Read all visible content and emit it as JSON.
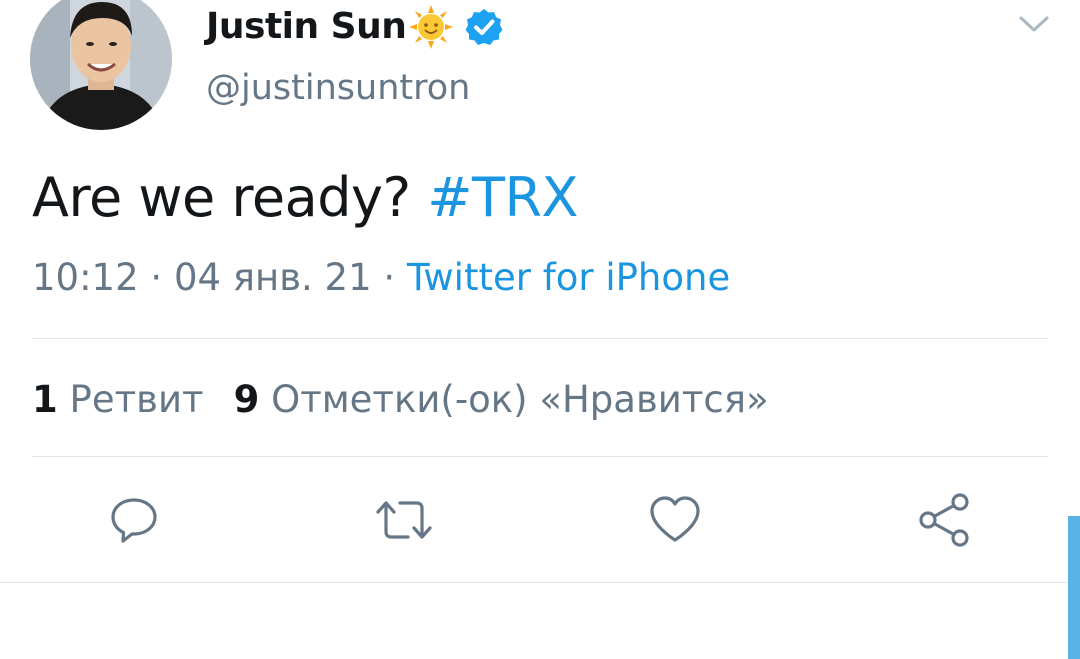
{
  "user": {
    "display_name": "Justin Sun",
    "name_emoji": "sun-with-face-icon",
    "verified_icon": "verified-badge-icon",
    "handle": "@justinsuntron"
  },
  "tweet": {
    "text_plain": "Are we ready? ",
    "hashtag": "#TRX",
    "time": "10:12",
    "separator": "·",
    "date": "04 янв. 21",
    "source": "Twitter for iPhone"
  },
  "stats": {
    "retweets_count": "1",
    "retweets_label": "Ретвит",
    "likes_count": "9",
    "likes_label": "Отметки(-ок) «Нравится»"
  },
  "actions": {
    "reply_icon": "comment-icon",
    "retweet_icon": "retweet-icon",
    "like_icon": "heart-icon",
    "share_icon": "share-icon",
    "menu_icon": "chevron-down-icon"
  },
  "colors": {
    "link": "#1b95e0",
    "secondary_text": "#657786",
    "primary_text": "#14171a",
    "divider": "#e1e8ed",
    "verified": "#1da1f2"
  }
}
